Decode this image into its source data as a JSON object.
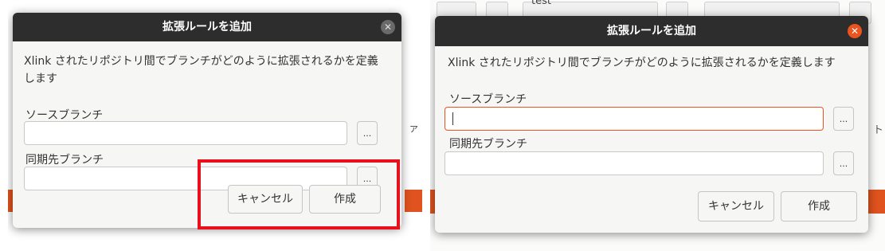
{
  "dialog": {
    "title": "拡張ルールを追加",
    "description": "Xlink されたリポジトリ間でブランチがどのように拡張されるかを定義します",
    "description_line1": "Xlink されたリポジトリ間でブランチがどのように拡張されるかを定義",
    "description_line2": "します",
    "source_label": "ソースブランチ",
    "target_label": "同期先ブランチ",
    "source_value": "",
    "target_value": "",
    "browse_label": "...",
    "cancel_label": "キャンセル",
    "create_label": "作成",
    "close_glyph": "✕"
  },
  "background": {
    "right_edge_glyph": "ト",
    "left_edge_glyph": "ァ",
    "search_fragment": "test"
  },
  "colors": {
    "titlebar": "#2d2d2d",
    "close_active": "#e95420",
    "highlight": "#e8101c",
    "focus_border": "#e95420"
  }
}
